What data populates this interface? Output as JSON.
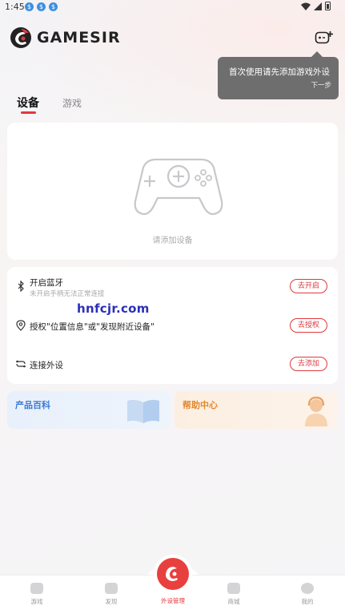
{
  "status_bar": {
    "time": "1:45"
  },
  "header": {
    "brand": "GAMESIR"
  },
  "tooltip": {
    "text": "首次使用请先添加游戏外设",
    "next": "下一步"
  },
  "tabs": [
    {
      "label": "设备"
    },
    {
      "label": "游戏"
    }
  ],
  "device_card": {
    "empty_label": "请添加设备"
  },
  "permissions": [
    {
      "title": "开启蓝牙",
      "subtitle": "未开启手柄无法正常连接",
      "button": "去开启",
      "icon": "bluetooth-icon"
    },
    {
      "title": "授权\"位置信息\"或\"发现附近设备\"",
      "button": "去授权",
      "icon": "location-icon"
    },
    {
      "title": "连接外设",
      "button": "去添加",
      "icon": "link-icon"
    }
  ],
  "watermark": "hnfcjr.com",
  "info_cards": {
    "products": "产品百科",
    "help": "帮助中心"
  },
  "bottom_nav": {
    "items": [
      "游戏",
      "发现",
      "外设管理",
      "商城",
      "我的"
    ],
    "active": "外设管理"
  },
  "colors": {
    "accent": "#e0393e",
    "products_title": "#3d7bd6",
    "help_title": "#e2882d",
    "watermark": "#2b2fb8"
  }
}
